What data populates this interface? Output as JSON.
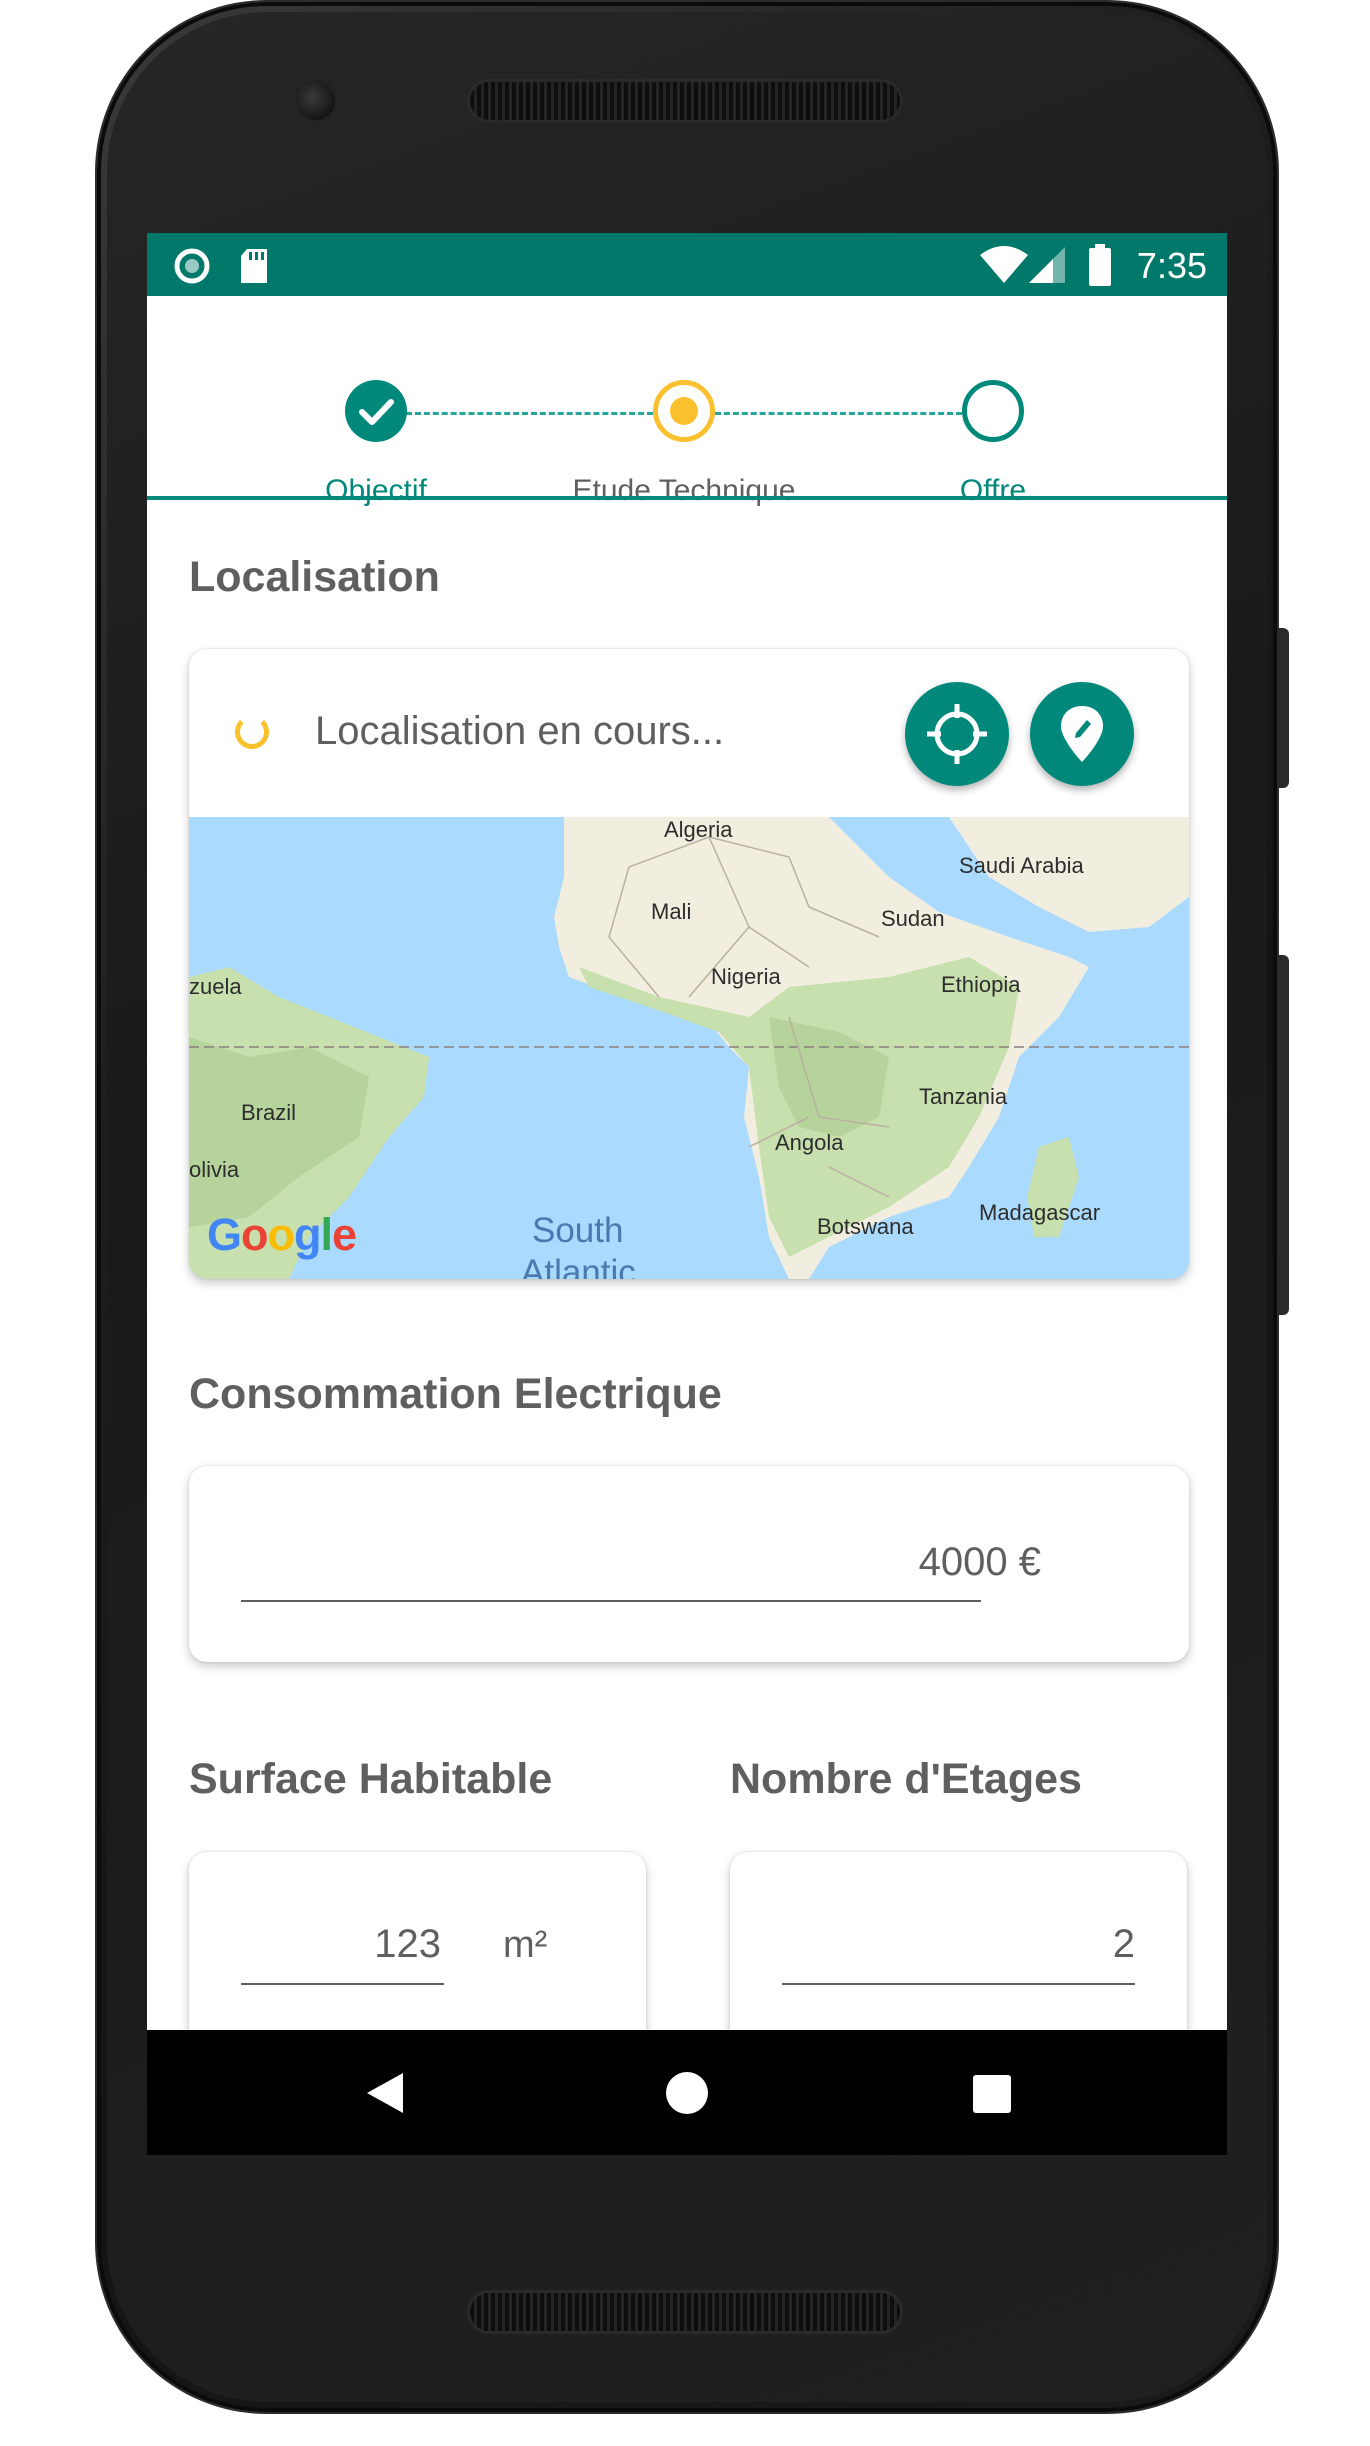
{
  "status_bar": {
    "time": "7:35",
    "left_icons": [
      "sync-icon",
      "sd-card-icon"
    ],
    "right_icons": [
      "wifi-icon",
      "signal-icon",
      "battery-icon"
    ],
    "color": "#00796b"
  },
  "stepper": {
    "steps": [
      {
        "label": "Objectif",
        "state": "completed"
      },
      {
        "label": "Etude Technique",
        "state": "current"
      },
      {
        "label": "Offre",
        "state": "pending"
      }
    ],
    "accent_color": "#00897b",
    "current_color": "#fbc02d"
  },
  "location": {
    "title": "Localisation",
    "status_text": "Localisation en cours...",
    "buttons": [
      "my-location-icon",
      "edit-location-icon"
    ],
    "map": {
      "labels": [
        "Algeria",
        "Saudi Arabia",
        "Mali",
        "Sudan",
        "Nigeria",
        "Ethiopia",
        "zuela",
        "Brazil",
        "Tanzania",
        "Angola",
        "olivia",
        "Madagascar",
        "Botswana"
      ],
      "ocean_lines": [
        "South",
        "Atlantic"
      ],
      "logo": "Google"
    }
  },
  "consumption": {
    "title": "Consommation Electrique",
    "value": "4000 €"
  },
  "surface": {
    "title": "Surface Habitable",
    "value": "123",
    "unit": "m²"
  },
  "floors": {
    "title": "Nombre d'Etages",
    "value": "2"
  },
  "nav_bar": {
    "buttons": [
      "back-icon",
      "home-icon",
      "recents-icon"
    ]
  }
}
